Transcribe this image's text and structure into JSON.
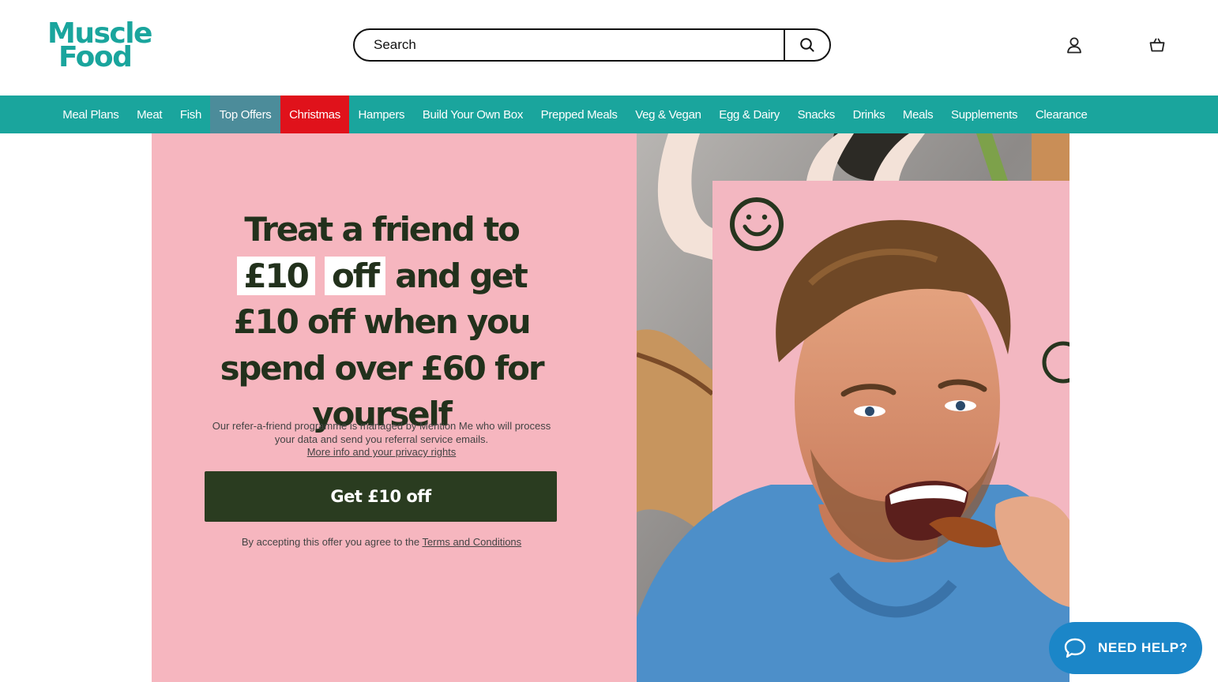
{
  "header": {
    "logo": {
      "line1": "Muscle",
      "line2": "Food"
    },
    "search": {
      "placeholder": "Search",
      "icon": "search-icon"
    },
    "account_icon": "user-icon",
    "basket_icon": "basket-icon"
  },
  "nav": {
    "items": [
      {
        "label": "Meal Plans"
      },
      {
        "label": "Meat"
      },
      {
        "label": "Fish"
      },
      {
        "label": "Top Offers"
      },
      {
        "label": "Christmas"
      },
      {
        "label": "Hampers"
      },
      {
        "label": "Build Your Own Box"
      },
      {
        "label": "Prepped Meals"
      },
      {
        "label": "Veg & Vegan"
      },
      {
        "label": "Egg & Dairy"
      },
      {
        "label": "Snacks"
      },
      {
        "label": "Drinks"
      },
      {
        "label": "Meals"
      },
      {
        "label": "Supplements"
      },
      {
        "label": "Clearance"
      }
    ]
  },
  "hero": {
    "headline": {
      "part1": "Treat a friend to",
      "highlight1": "£10",
      "highlight2": "off",
      "part2": "and get £10 off when you spend over £60 for yourself"
    },
    "disclaimer": "Our refer-a-friend programme is managed by Mention Me who will process your data and send you referral service emails.",
    "privacy_link": "More info and your privacy rights",
    "cta_label": "Get £10 off",
    "terms_text": "By accepting this offer you agree to the",
    "terms_link": "Terms and Conditions"
  },
  "help": {
    "label": "NEED HELP?",
    "icon": "chat-bubble-icon"
  },
  "colors": {
    "brand_teal": "#1aa59d",
    "top_offers_bg": "#4c8c9a",
    "christmas_red": "#e0121b",
    "hero_pink": "#f6b6bf",
    "dark_green": "#2a3c20",
    "help_blue": "#1b86c8"
  }
}
